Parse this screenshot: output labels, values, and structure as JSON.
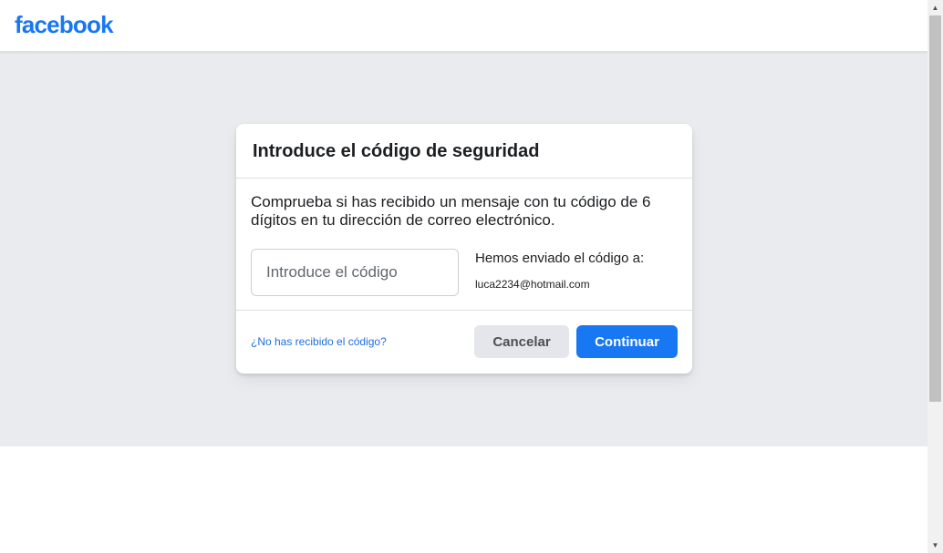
{
  "header": {
    "logo_text": "facebook"
  },
  "dialog": {
    "title": "Introduce el código de seguridad",
    "description": "Comprueba si has recibido un mensaje con tu código de 6 dígitos en tu dirección de correo electrónico.",
    "code_input": {
      "placeholder": "Introduce el código",
      "value": ""
    },
    "sent_label": "Hemos enviado el código a:",
    "sent_email": "luca2234@hotmail.com",
    "resend_link": "¿No has recibido el código?",
    "cancel_label": "Cancelar",
    "continue_label": "Continuar"
  },
  "colors": {
    "brand": "#1877f2",
    "background": "#e9ebee",
    "link": "#216fdb"
  },
  "scrollbar": {
    "up_icon": "scroll-up-arrow-icon",
    "down_icon": "scroll-down-arrow-icon"
  }
}
